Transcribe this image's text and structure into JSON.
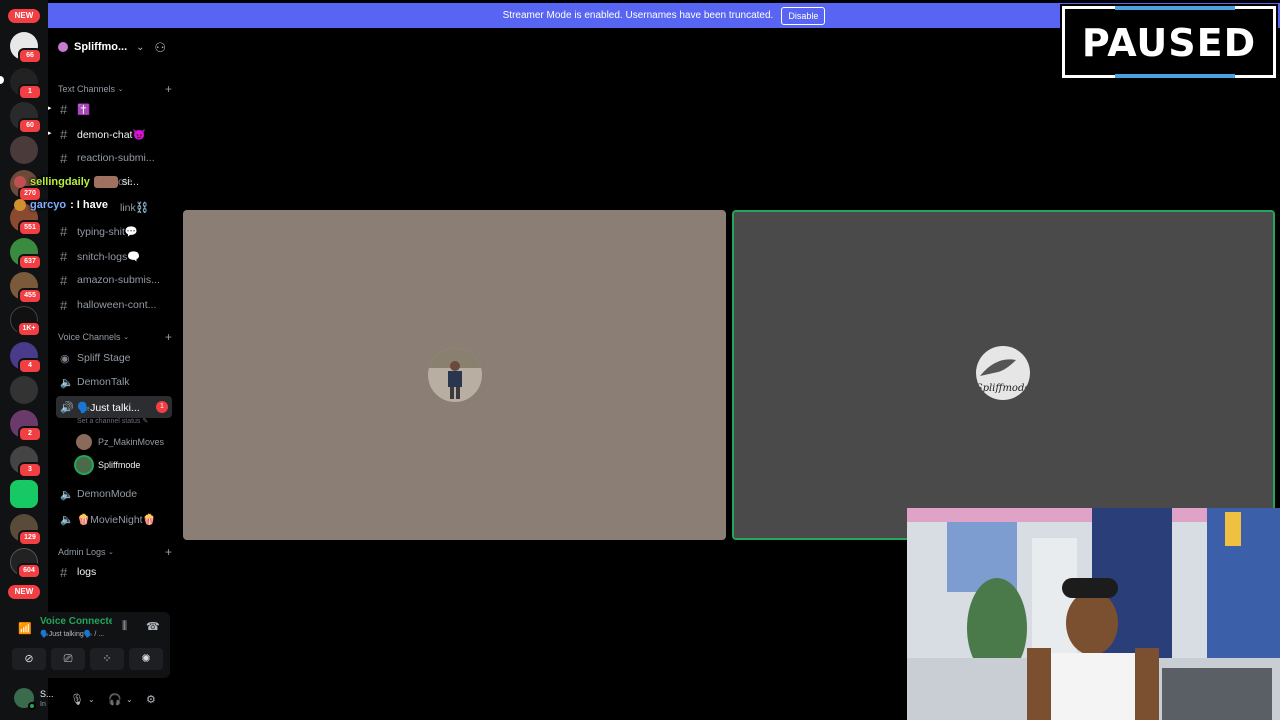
{
  "banner": {
    "message": "Streamer Mode is enabled. Usernames have been truncated.",
    "disable_label": "Disable"
  },
  "overlay": {
    "paused_label": "PAUSED"
  },
  "servers": [
    {
      "label": "NEW",
      "type": "pill"
    },
    {
      "badge": "66"
    },
    {
      "badge": "1"
    },
    {
      "badge": "60"
    },
    {
      "badge": ""
    },
    {
      "badge": "270"
    },
    {
      "badge": "551"
    },
    {
      "badge": "637"
    },
    {
      "badge": "455"
    },
    {
      "badge": "1K+"
    },
    {
      "badge": "4"
    },
    {
      "badge": ""
    },
    {
      "badge": "2"
    },
    {
      "badge": "3"
    },
    {
      "badge": ""
    },
    {
      "badge": "129"
    },
    {
      "badge": "604"
    },
    {
      "label": "NEW",
      "type": "pill"
    }
  ],
  "server": {
    "name": "Spliffmo..."
  },
  "categories": {
    "text": "Text Channels",
    "voice": "Voice Channels",
    "admin": "Admin Logs"
  },
  "text_channels": [
    {
      "name": "✝️",
      "bold": true
    },
    {
      "name": "demon-chat😈",
      "bold": true
    },
    {
      "name": "reaction-submi...",
      "bold": false
    },
    {
      "name": "ote",
      "bold": false
    },
    {
      "name": "link⛓️",
      "bold": false
    },
    {
      "name": "typing-shit💬",
      "bold": false
    },
    {
      "name": "snitch-logs🗨️",
      "bold": false
    },
    {
      "name": "amazon-submis...",
      "bold": false
    },
    {
      "name": "halloween-cont...",
      "bold": false
    }
  ],
  "voice_channels": [
    {
      "name": "Spliff Stage",
      "icon": "stage-icon"
    },
    {
      "name": "DemonTalk",
      "icon": "speaker-icon"
    },
    {
      "name": "🗣️Just talki...",
      "icon": "speaker-icon",
      "active": true,
      "badge": "1",
      "status": "Set a channel status"
    },
    {
      "name": "DemonMode",
      "icon": "speaker-icon"
    },
    {
      "name": "🍿MovieNight🍿",
      "icon": "speaker-icon"
    }
  ],
  "voice_users": [
    {
      "name": "Pz_MakinMoves"
    },
    {
      "name": "Spliffmode"
    }
  ],
  "admin_channels": [
    {
      "name": "logs"
    }
  ],
  "chat_overlay": [
    {
      "user": "sellingdaily",
      "text": "si..."
    },
    {
      "user": "garcyo",
      "text": ": I have"
    }
  ],
  "voice_panel": {
    "title": "Voice Connected",
    "subtitle": "🗣️Just talking🗣️ / ..."
  },
  "user_panel": {
    "name": "S...",
    "status": "In"
  },
  "tiles": [
    {
      "name": "participant-tile-1"
    },
    {
      "name": "participant-tile-2",
      "caption": "Spliffmode"
    }
  ],
  "colors": {
    "blurple": "#5865f2",
    "green": "#23a55a",
    "red": "#f23f43"
  }
}
